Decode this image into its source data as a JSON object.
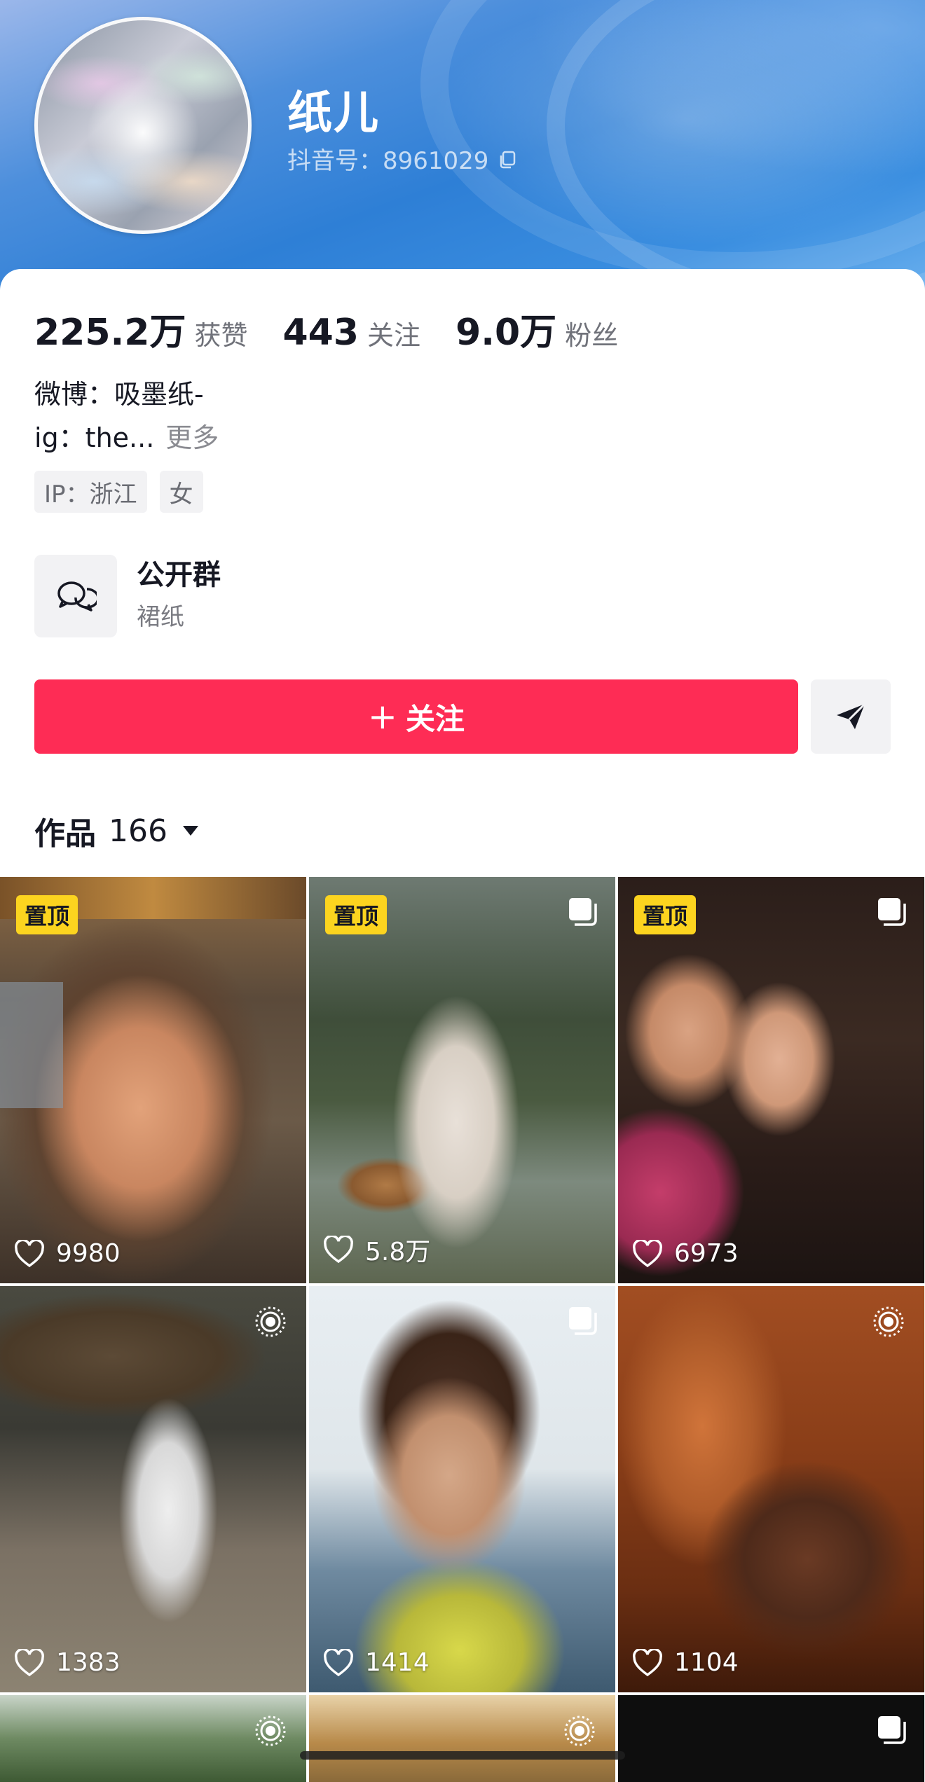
{
  "profile": {
    "name": "纸儿",
    "douyin_id": "抖音号：8961029"
  },
  "stats": [
    {
      "value": "225.2万",
      "label": "获赞"
    },
    {
      "value": "443",
      "label": "关注"
    },
    {
      "value": "9.0万",
      "label": "粉丝"
    }
  ],
  "bio": {
    "line1": "微博：吸墨纸-",
    "line2": "ig：the...",
    "more": "更多"
  },
  "tags": [
    "IP：浙江",
    "女"
  ],
  "group": {
    "title": "公开群",
    "subtitle": "裙纸"
  },
  "actions": {
    "follow_plus": "+",
    "follow_label": "关注"
  },
  "works": {
    "label": "作品",
    "count": "166"
  },
  "videos": [
    {
      "likes": "9980",
      "pinned": "置顶",
      "badge": "none"
    },
    {
      "likes": "5.8万",
      "pinned": "置顶",
      "badge": "multi-image-icon"
    },
    {
      "likes": "6973",
      "pinned": "置顶",
      "badge": "multi-image-icon"
    },
    {
      "likes": "1383",
      "pinned": "",
      "badge": "live-photo-icon"
    },
    {
      "likes": "1414",
      "pinned": "",
      "badge": "multi-image-icon"
    },
    {
      "likes": "1104",
      "pinned": "",
      "badge": "live-photo-icon"
    }
  ],
  "colors": {
    "accent": "#fe2c55",
    "pin_badge": "#fcd41f",
    "header_blue": "#2e7fd6"
  }
}
